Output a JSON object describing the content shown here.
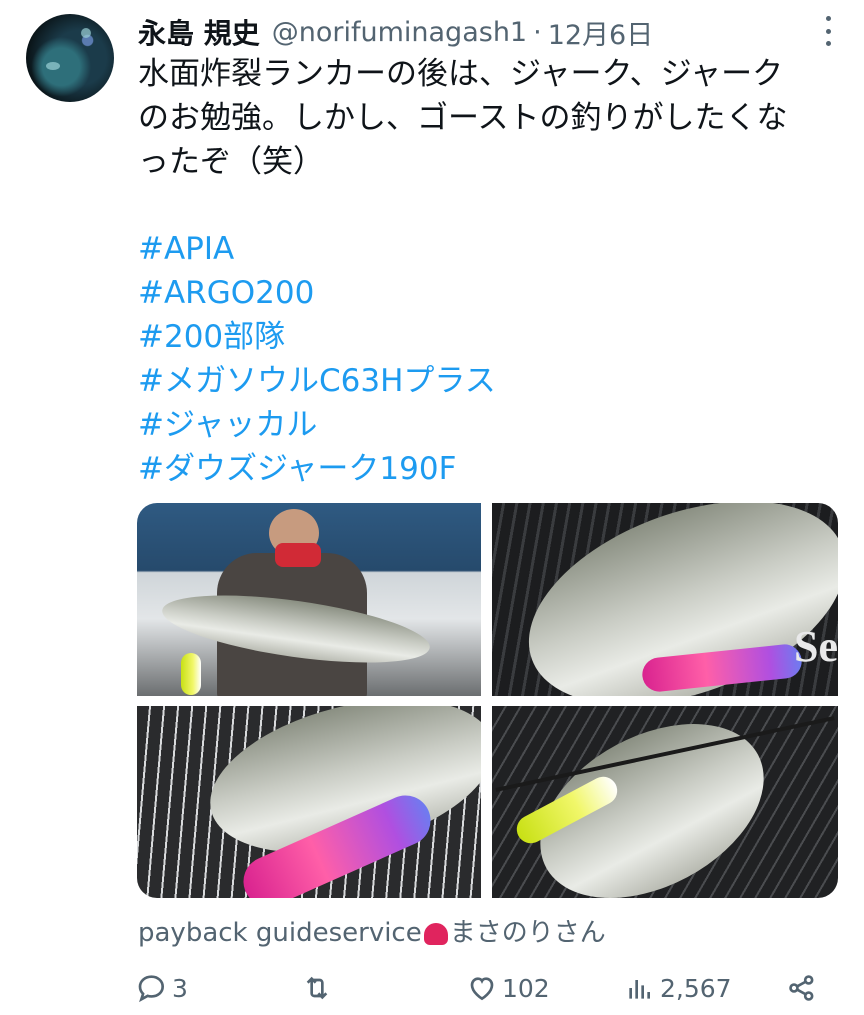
{
  "header": {
    "display_name": "永島 規史",
    "handle": "@norifuminagash1",
    "separator": "·",
    "date": "12月6日"
  },
  "tweet": {
    "lines": [
      "水面炸裂ランカーの後は、ジャーク、ジャーク",
      "のお勉強。しかし、ゴーストの釣りがしたくな",
      "ったぞ（笑）"
    ],
    "hashtags": [
      "#APIA",
      "#ARGO200",
      "#200部隊",
      "#メガソウルC63Hプラス",
      "#ジャッカル",
      "#ダウズジャーク190F"
    ]
  },
  "media": {
    "photos": [
      "angler-holding-seabass",
      "seabass-with-pink-lure",
      "seabass-closeup-pink-lure",
      "seabass-with-yellow-lure"
    ]
  },
  "tagged": {
    "prefix": "payback guideservice",
    "suffix": "まさのりさん"
  },
  "actions": {
    "replies": "3",
    "retweets": "",
    "likes": "102",
    "views": "2,567"
  },
  "colors": {
    "hashtag": "#1d9bf0",
    "secondary_text": "#536471"
  }
}
